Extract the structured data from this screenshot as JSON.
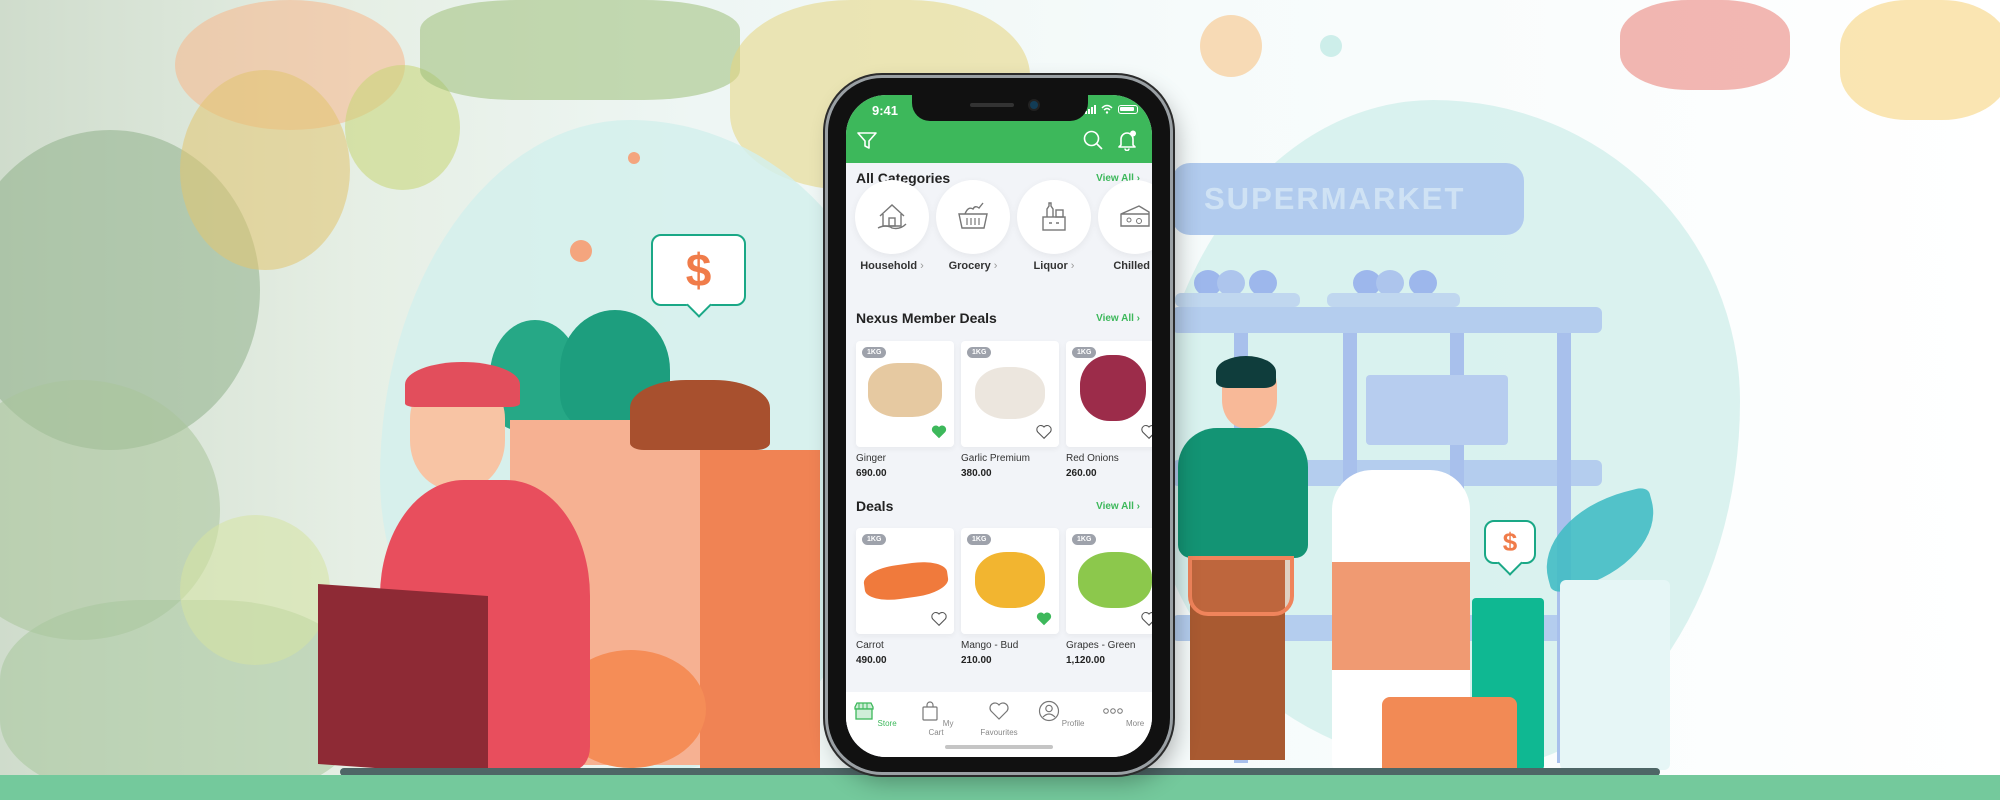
{
  "banner": {
    "sign_text": "SUPERMARKET",
    "bubble_symbol": "$",
    "colors": {
      "brand_green": "#3db85b",
      "accent_orange": "#f07c4a",
      "teal": "#1aa886",
      "ground": "#74c99c"
    }
  },
  "phone": {
    "status": {
      "time": "9:41"
    },
    "header": {
      "filter_icon": "filter-icon",
      "search_icon": "search-icon",
      "bell_icon": "bell-icon"
    },
    "categories": {
      "title": "All Categories",
      "view_all": "View All",
      "items": [
        {
          "label": "Household",
          "icon": "house-icon"
        },
        {
          "label": "Grocery",
          "icon": "basket-icon"
        },
        {
          "label": "Liquor",
          "icon": "bottles-icon"
        },
        {
          "label": "Chilled",
          "icon": "cheese-icon"
        }
      ]
    },
    "member_deals": {
      "title": "Nexus Member Deals",
      "view_all": "View All",
      "items": [
        {
          "badge": "1KG",
          "name": "Ginger",
          "price": "690.00",
          "favourite": true
        },
        {
          "badge": "1KG",
          "name": "Garlic Premium",
          "price": "380.00",
          "favourite": false
        },
        {
          "badge": "1KG",
          "name": "Red Onions",
          "price": "260.00",
          "favourite": false
        }
      ]
    },
    "deals": {
      "title": "Deals",
      "view_all": "View All",
      "items": [
        {
          "badge": "1KG",
          "name": "Carrot",
          "price": "490.00",
          "favourite": false
        },
        {
          "badge": "1KG",
          "name": "Mango - Bud",
          "price": "210.00",
          "favourite": true
        },
        {
          "badge": "1KG",
          "name": "Grapes - Green",
          "price": "1,120.00",
          "favourite": false
        }
      ]
    },
    "nav": [
      {
        "label": "Store",
        "icon": "store-icon",
        "active": true
      },
      {
        "label": "My Cart",
        "icon": "bag-icon",
        "active": false
      },
      {
        "label": "Favourites",
        "icon": "heart-icon",
        "active": false
      },
      {
        "label": "Profile",
        "icon": "profile-icon",
        "active": false
      },
      {
        "label": "More",
        "icon": "more-icon",
        "active": false
      }
    ]
  }
}
